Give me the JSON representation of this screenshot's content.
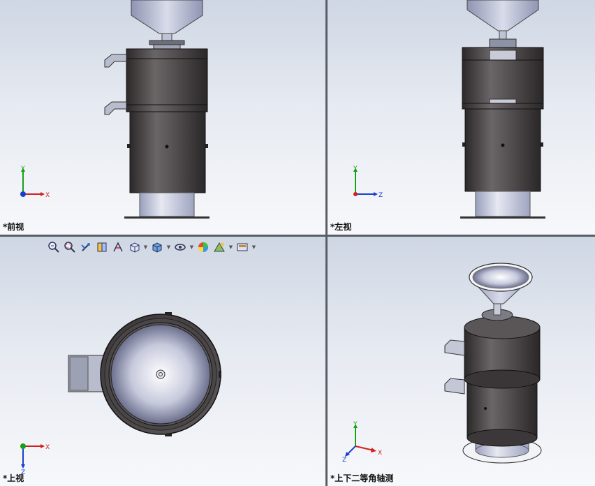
{
  "viewports": {
    "front": {
      "label": "*前视"
    },
    "left": {
      "label": "*左视"
    },
    "top": {
      "label": "*上视"
    },
    "iso": {
      "label": "*上下二等角轴测"
    }
  },
  "triads": {
    "front": {
      "vertical": "Y",
      "horizontal": "X"
    },
    "left": {
      "vertical": "Y",
      "horizontal": "Z"
    },
    "top": {
      "vertical": "Z",
      "horizontal": "X"
    },
    "iso": {
      "vertical": "Y",
      "horizontal": "X",
      "depth": "Z"
    }
  },
  "heads_up_toolbar": {
    "items": [
      {
        "name": "zoom-to-fit-icon",
        "has_dropdown": false
      },
      {
        "name": "zoom-to-area-icon",
        "has_dropdown": false
      },
      {
        "name": "previous-view-icon",
        "has_dropdown": false
      },
      {
        "name": "section-view-icon",
        "has_dropdown": false
      },
      {
        "name": "dynamic-annotation-icon",
        "has_dropdown": false
      },
      {
        "name": "view-orientation-icon",
        "has_dropdown": true
      },
      {
        "name": "display-style-icon",
        "has_dropdown": true
      },
      {
        "name": "hide-show-items-icon",
        "has_dropdown": true
      },
      {
        "name": "edit-appearance-icon",
        "has_dropdown": false
      },
      {
        "name": "apply-scene-icon",
        "has_dropdown": true
      },
      {
        "name": "view-settings-icon",
        "has_dropdown": true
      }
    ]
  },
  "colors": {
    "x_axis": "#d02020",
    "y_axis": "#18a018",
    "z_axis": "#1a3fd0",
    "body_dark": "#4a4647",
    "metal_light": "#c8cde0"
  }
}
